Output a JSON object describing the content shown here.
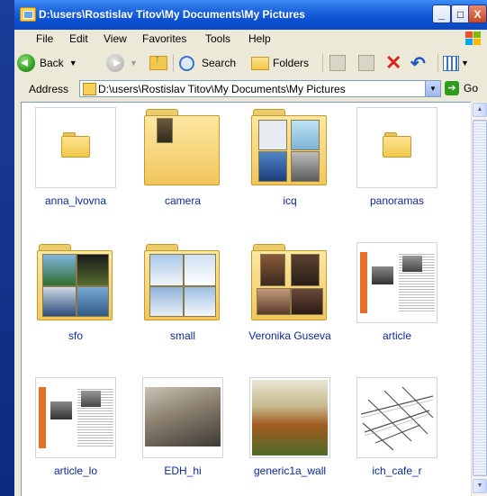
{
  "window": {
    "title": "D:\\users\\Rostislav Titov\\My Documents\\My Pictures",
    "minimize_label": "_",
    "maximize_label": "□",
    "close_label": "X"
  },
  "menu": {
    "items": [
      "File",
      "Edit",
      "View",
      "Favorites",
      "Tools",
      "Help"
    ]
  },
  "toolbar": {
    "back_label": "Back",
    "search_label": "Search",
    "folders_label": "Folders"
  },
  "address": {
    "label": "Address",
    "value": "D:\\users\\Rostislav Titov\\My Documents\\My Pictures",
    "go_label": "Go"
  },
  "files": [
    {
      "name": "anna_lvovna",
      "kind": "folder-empty"
    },
    {
      "name": "camera",
      "kind": "folder-preview"
    },
    {
      "name": "icq",
      "kind": "folder-preview"
    },
    {
      "name": "panoramas",
      "kind": "folder-empty"
    },
    {
      "name": "sfo",
      "kind": "folder-preview"
    },
    {
      "name": "small",
      "kind": "folder-preview"
    },
    {
      "name": "Veronika Guseva",
      "kind": "folder-preview"
    },
    {
      "name": "article",
      "kind": "image"
    },
    {
      "name": "article_lo",
      "kind": "image"
    },
    {
      "name": "EDH_hi",
      "kind": "image"
    },
    {
      "name": "generic1a_wall",
      "kind": "image"
    },
    {
      "name": "ich_cafe_r",
      "kind": "image"
    }
  ],
  "colors": {
    "titlebar": "#0b4fd1",
    "label_text": "#0c2a9a",
    "folder_yellow": "#f1c75c"
  }
}
